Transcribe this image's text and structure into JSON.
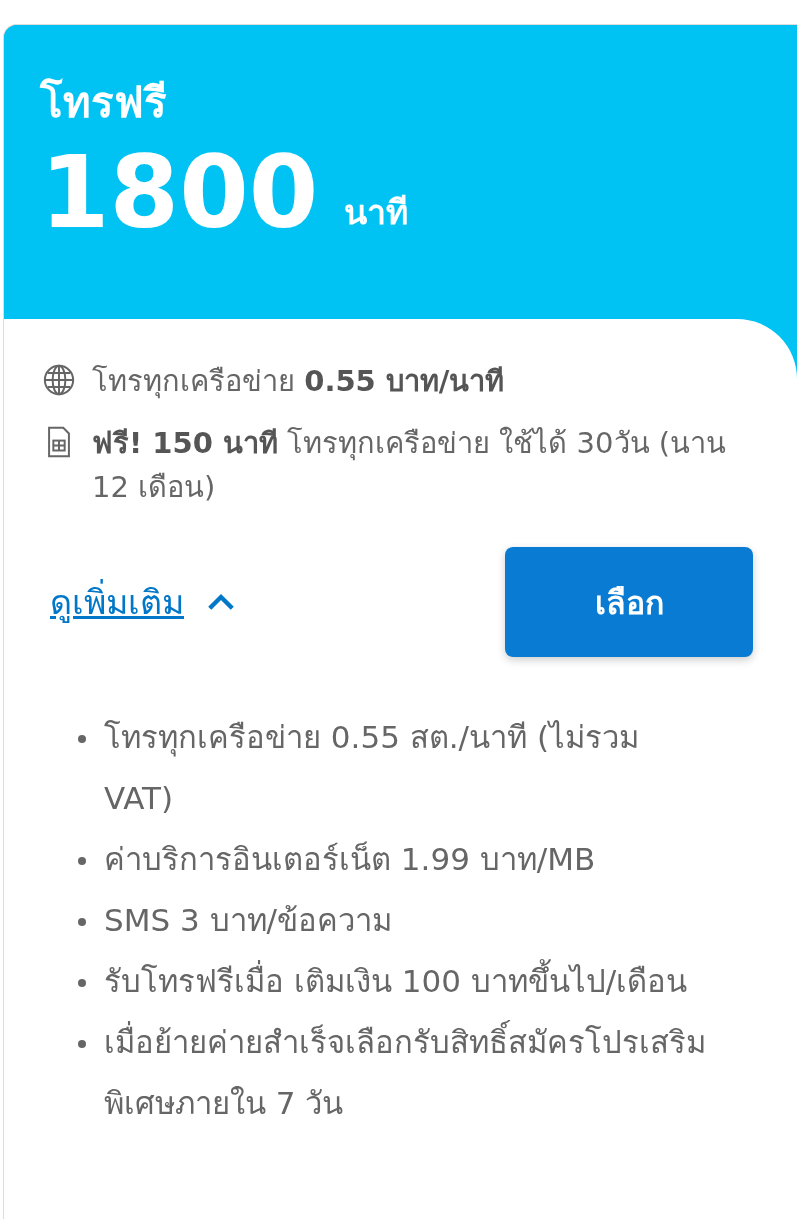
{
  "header": {
    "title": "โทรฟรี",
    "amount": "1800",
    "unit": "นาที"
  },
  "features": [
    {
      "kind": "globe",
      "text": "โทรทุกเครือข่าย **0.55 บาท/นาที**"
    },
    {
      "kind": "sim",
      "text": "**ฟรี! 150 นาที**  โทรทุกเครือข่าย ใช้ได้ 30วัน (นาน 12 เดือน)"
    }
  ],
  "more_link": {
    "label": "ดูเพิ่มเติม",
    "expanded": true
  },
  "select_button": {
    "label": "เลือก"
  },
  "details": [
    "โทรทุกเครือข่าย 0.55 สต./นาที (ไม่รวม VAT)",
    "ค่าบริการอินเตอร์เน็ต 1.99 บาท/MB",
    "SMS 3 บาท/ข้อความ",
    "รับโทรฟรีเมื่อ เติมเงิน 100 บาทขึ้นไป/เดือน",
    "เมื่อย้ายค่ายสำเร็จเลือกรับสิทธิ์สมัครโปรเสริมพิเศษภายใน 7 วัน"
  ]
}
